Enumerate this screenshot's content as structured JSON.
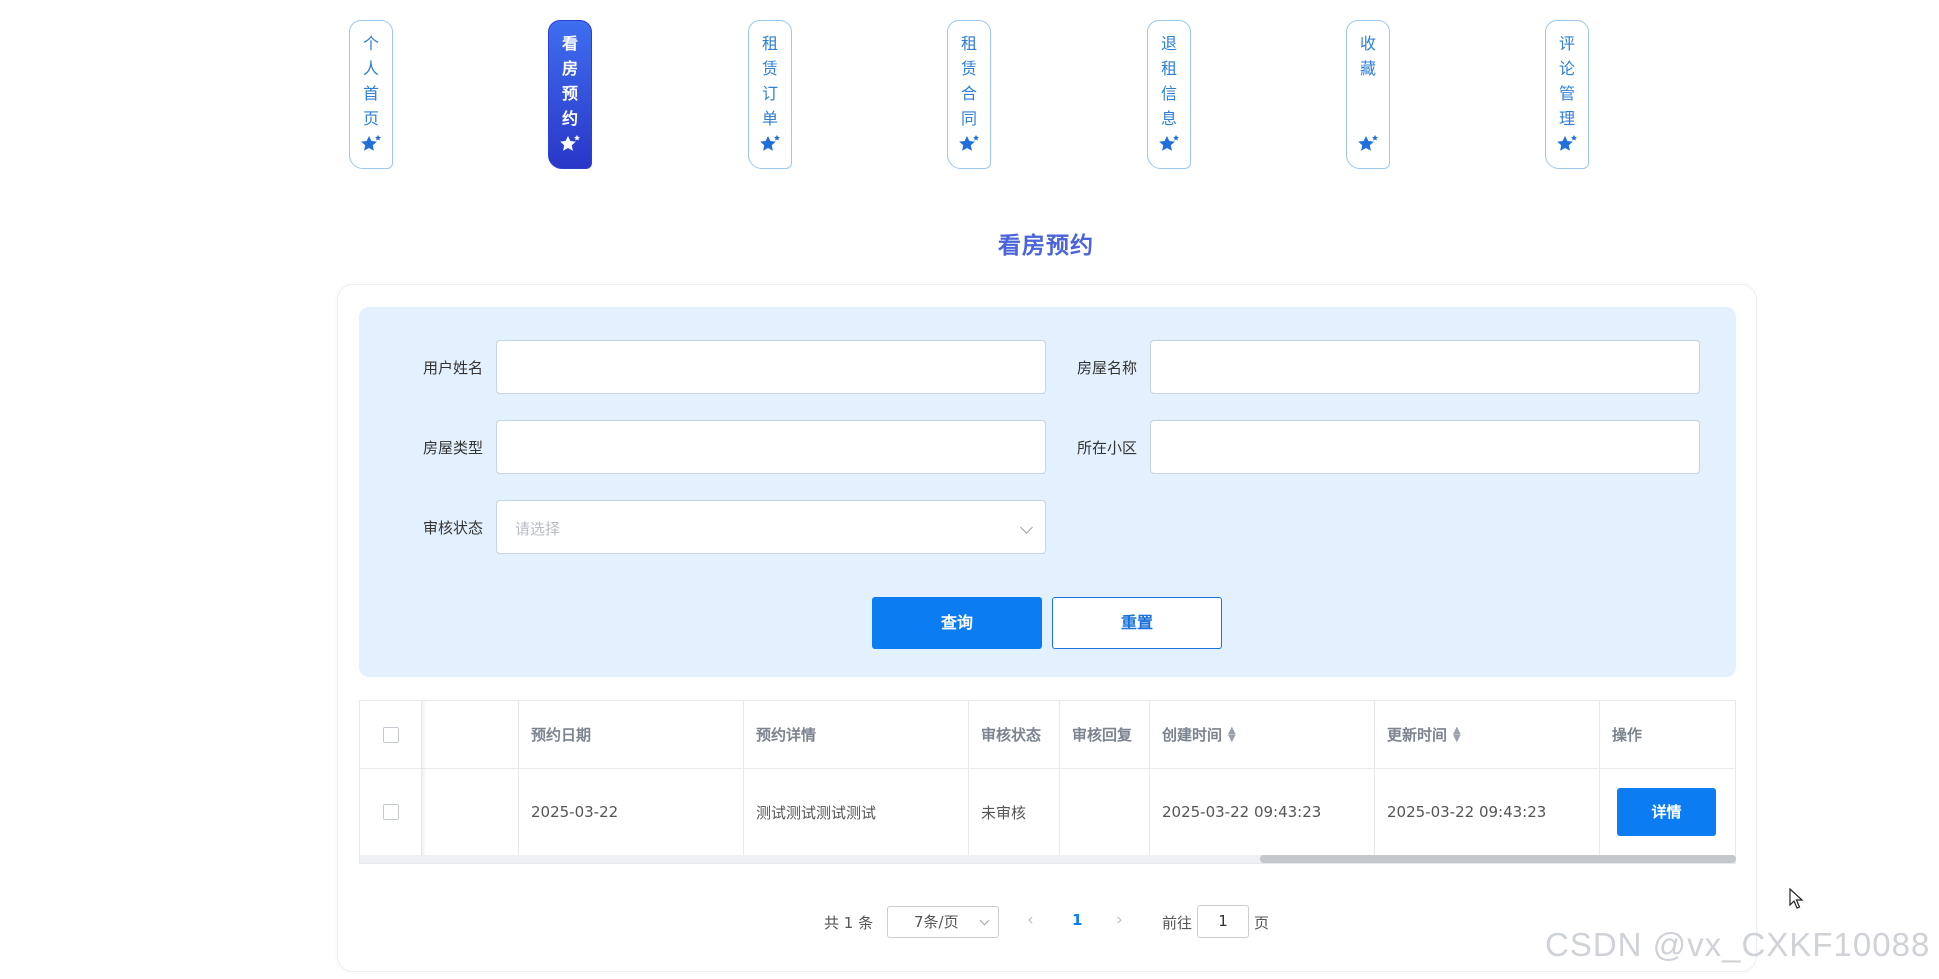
{
  "nav": {
    "tabs": [
      {
        "label": "个人首页",
        "active": false
      },
      {
        "label": "看房预约",
        "active": true
      },
      {
        "label": "租赁订单",
        "active": false
      },
      {
        "label": "租赁合同",
        "active": false
      },
      {
        "label": "退租信息",
        "active": false
      },
      {
        "label": "收藏",
        "active": false
      },
      {
        "label": "评论管理",
        "active": false
      }
    ],
    "icon": "star-icon"
  },
  "page_title": "看房预约",
  "search": {
    "fields": {
      "username": {
        "label": "用户姓名",
        "value": ""
      },
      "house_name": {
        "label": "房屋名称",
        "value": ""
      },
      "house_type": {
        "label": "房屋类型",
        "value": ""
      },
      "community": {
        "label": "所在小区",
        "value": ""
      },
      "review_status": {
        "label": "审核状态",
        "placeholder": "请选择"
      }
    },
    "query_button": "查询",
    "reset_button": "重置"
  },
  "table": {
    "columns": [
      "",
      "",
      "预约日期",
      "预约详情",
      "审核状态",
      "审核回复",
      "创建时间",
      "更新时间",
      "操作"
    ],
    "rows": [
      {
        "date": "2025-03-22",
        "detail": "测试测试测试测试",
        "status": "未审核",
        "reply": "",
        "created": "2025-03-22 09:43:23",
        "updated": "2025-03-22 09:43:23",
        "action": "详情"
      }
    ]
  },
  "pagination": {
    "total": "共 1 条",
    "page_size": "7条/页",
    "current_page": "1",
    "goto_label": "前往",
    "goto_value": "1",
    "page_suffix": "页"
  },
  "watermark": "CSDN @vx_CXKF10088",
  "colors": {
    "primary": "#0b7cf2",
    "nav_border": "#9cc7f0",
    "nav_text": "#2e7fd6",
    "active_tab": "#3248d8",
    "panel_bg": "#e3f0fd",
    "title": "#4a63d8"
  }
}
